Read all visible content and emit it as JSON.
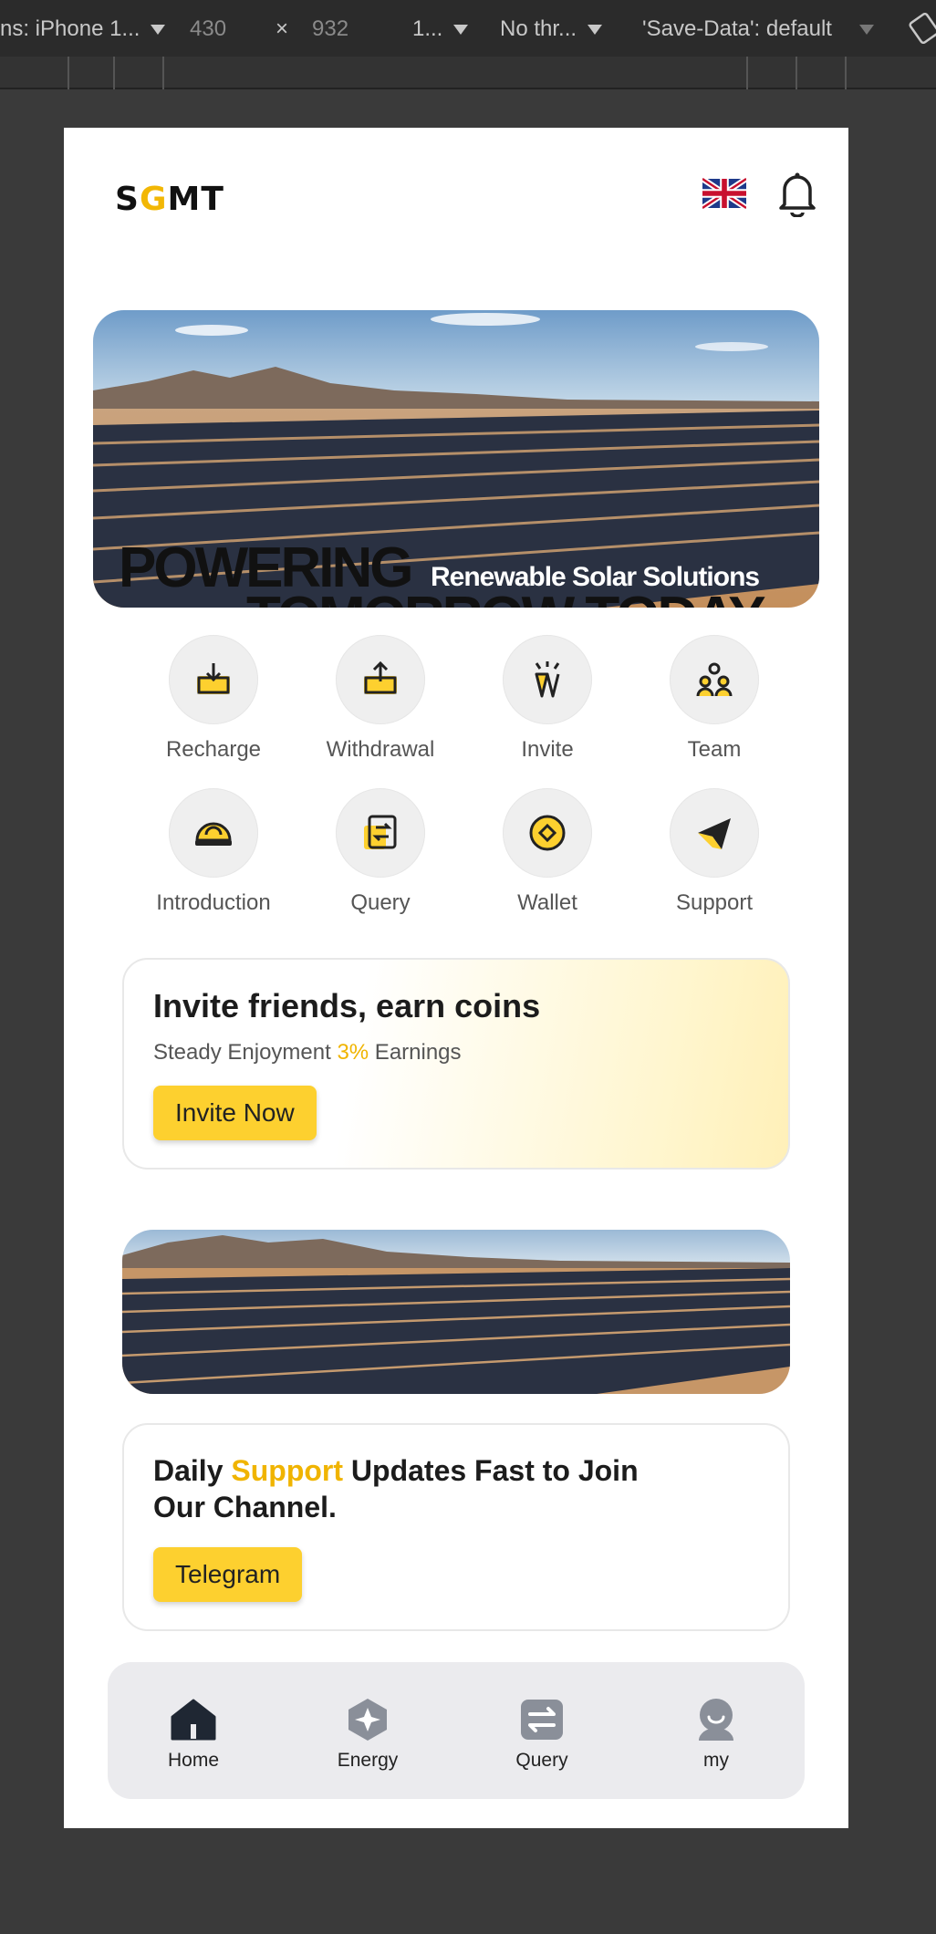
{
  "devtools": {
    "device": "ns: iPhone 1...",
    "width": "430",
    "times": "×",
    "height": "932",
    "zoom": "1...",
    "throttle": "No thr...",
    "save_data": "'Save-Data': default"
  },
  "header": {
    "logo_part1": "S",
    "logo_part2": "G",
    "logo_part3": "MT",
    "language": "flag-uk"
  },
  "banner": {
    "headline": "POWERING",
    "subline": "Renewable Solar Solutions",
    "secondline": "TOMORROW TODAY"
  },
  "actions": [
    {
      "label": "Recharge",
      "icon": "recharge-icon"
    },
    {
      "label": "Withdrawal",
      "icon": "withdrawal-icon"
    },
    {
      "label": "Invite",
      "icon": "invite-icon"
    },
    {
      "label": "Team",
      "icon": "team-icon"
    },
    {
      "label": "Introduction",
      "icon": "introduction-icon"
    },
    {
      "label": "Query",
      "icon": "query-icon"
    },
    {
      "label": "Wallet",
      "icon": "wallet-icon"
    },
    {
      "label": "Support",
      "icon": "support-icon"
    }
  ],
  "invite_card": {
    "title": "Invite friends, earn coins",
    "sub_prefix": "Steady Enjoyment ",
    "sub_highlight": "3%",
    "sub_suffix": " Earnings",
    "button": "Invite Now"
  },
  "telegram_card": {
    "title_prefix": "Daily ",
    "title_highlight": "Support",
    "title_suffix": " Updates Fast to Join Our Channel.",
    "button": "Telegram"
  },
  "bottom_nav": [
    {
      "label": "Home",
      "icon": "home-icon",
      "active": true
    },
    {
      "label": "Energy",
      "icon": "energy-icon",
      "active": false
    },
    {
      "label": "Query",
      "icon": "exchange-icon",
      "active": false
    },
    {
      "label": "my",
      "icon": "profile-icon",
      "active": false
    }
  ],
  "colors": {
    "accent": "#fdd02f",
    "highlight": "#f0b400",
    "background": "#ffffff",
    "nav_bg": "#ebebee"
  }
}
